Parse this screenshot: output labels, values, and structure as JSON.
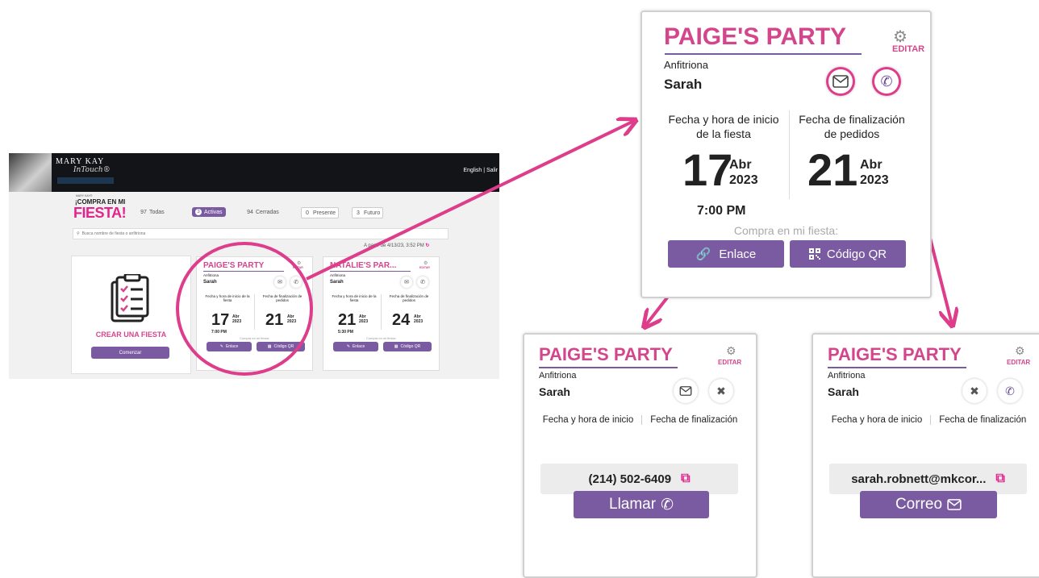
{
  "app": {
    "logo": "MARY KAY",
    "logo_sub": "InTouch®",
    "lang": "English | Salir",
    "brand_small": "MARY KAY®",
    "brand_line1": "¡COMPRA EN MI",
    "brand_line2": "FIESTA!",
    "tabs": [
      {
        "count": "97",
        "label": "Todas"
      },
      {
        "count": "3",
        "label": "Activas"
      },
      {
        "count": "94",
        "label": "Cerradas"
      },
      {
        "count": "0",
        "label": "Presente"
      },
      {
        "count": "3",
        "label": "Futuro"
      }
    ],
    "search_placeholder": "Busca nombre de fiesta o anfitriona",
    "as_of": "A partir de 4/13/23, 3:52 PM",
    "create_title": "CREAR UNA FIESTA",
    "create_button": "Comenzar",
    "cards": [
      {
        "title": "PAIGE'S PARTY",
        "edit": "EDITAR",
        "host_label": "Anfitriona",
        "host": "Sarah",
        "start_label": "Fecha y hora de inicio de la fiesta",
        "end_label": "Fecha de finalización de pedidos",
        "start_day": "17",
        "start_month": "Abr",
        "start_year": "2023",
        "end_day": "21",
        "end_month": "Abr",
        "end_year": "2023",
        "time": "7:00 PM",
        "buy_label": "Compra en mi fiesta:",
        "link_button": "Enlace",
        "qr_button": "Código QR"
      },
      {
        "title": "NATALIE'S PAR...",
        "edit": "EDITAR",
        "host_label": "Anfitriona",
        "host": "Sarah",
        "start_label": "Fecha y hora de inicio de la fiesta",
        "end_label": "Fecha de finalización de pedidos",
        "start_day": "21",
        "start_month": "Abr",
        "start_year": "2023",
        "end_day": "24",
        "end_month": "Abr",
        "end_year": "2023",
        "time": "5:30 PM",
        "buy_label": "Compra en mi fiesta:",
        "link_button": "Enlace",
        "qr_button": "Código QR"
      }
    ]
  },
  "main_card": {
    "title": "PAIGE'S PARTY",
    "edit": "EDITAR",
    "host_label": "Anfitriona",
    "host": "Sarah",
    "start_label": "Fecha y hora de inicio de la fiesta",
    "end_label": "Fecha de finalización de pedidos",
    "start_day": "17",
    "start_month": "Abr",
    "start_year": "2023",
    "end_day": "21",
    "end_month": "Abr",
    "end_year": "2023",
    "time": "7:00 PM",
    "buy_label": "Compra en mi fiesta:",
    "link_button": "Enlace",
    "qr_button": "Código QR"
  },
  "phone_card": {
    "title": "PAIGE'S PARTY",
    "edit": "EDITAR",
    "host_label": "Anfitriona",
    "host": "Sarah",
    "start_label": "Fecha y hora de inicio",
    "end_label": "Fecha de finalización",
    "value": "(214) 502-6409",
    "action": "Llamar"
  },
  "email_card": {
    "title": "PAIGE'S PARTY",
    "edit": "EDITAR",
    "host_label": "Anfitriona",
    "host": "Sarah",
    "start_label": "Fecha y hora de inicio",
    "end_label": "Fecha de finalización",
    "value": "sarah.robnett@mkcor...",
    "action": "Correo"
  },
  "colors": {
    "pink": "#d4468c",
    "purple": "#7a5ba2",
    "arrow": "#dd3d8a"
  }
}
